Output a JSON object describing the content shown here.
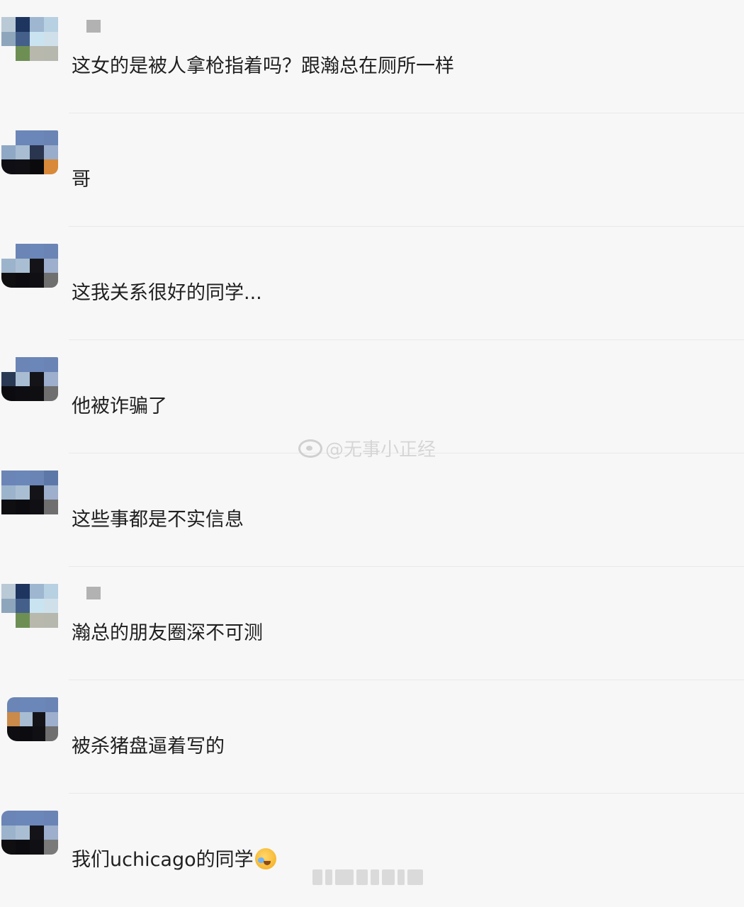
{
  "comments": [
    {
      "text": "这女的是被人拿枪指着吗？跟瀚总在厕所一样",
      "avatar": "grid"
    },
    {
      "text": "哥",
      "avatar": "blue"
    },
    {
      "text": "这我关系很好的同学...",
      "avatar": "blue"
    },
    {
      "text": "他被诈骗了",
      "avatar": "blue"
    },
    {
      "text": "这些事都是不实信息",
      "avatar": "blue"
    },
    {
      "text": "瀚总的朋友圈深不可测",
      "avatar": "grid"
    },
    {
      "text": "被杀猪盘逼着写的",
      "avatar": "blue"
    },
    {
      "text": "我们uchicago的同学",
      "avatar": "blue",
      "emoji": "laughing-crying-emoji"
    }
  ],
  "watermark": {
    "text": "@无事小正经",
    "icon": "weibo-icon"
  },
  "colors": {
    "background": "#f7f7f7",
    "text": "#1f1f1f",
    "separator": "#e9e9e9"
  }
}
